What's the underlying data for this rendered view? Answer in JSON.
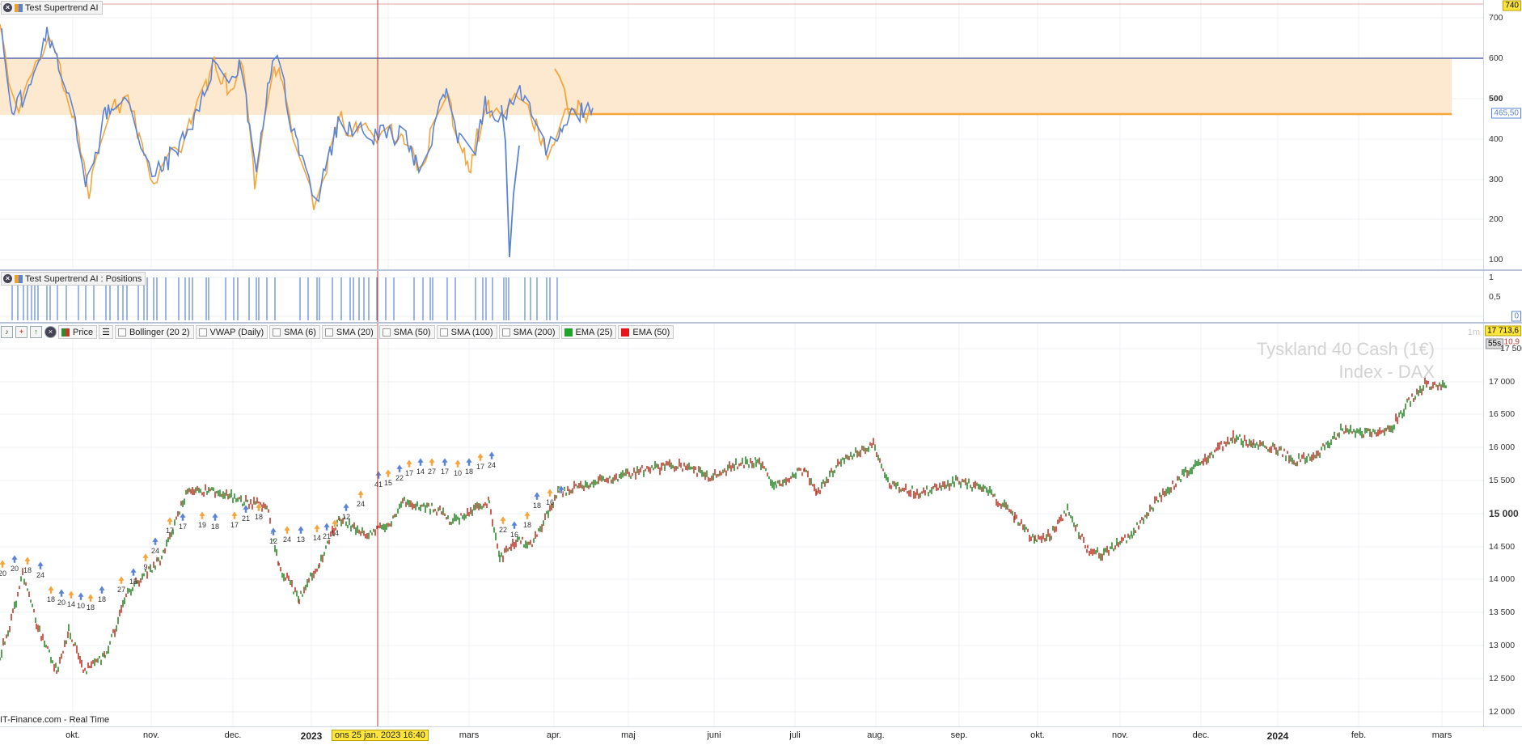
{
  "panel1": {
    "title": "Test Supertrend AI",
    "y_ticks": [
      "700",
      "600",
      "500",
      "400",
      "300",
      "200",
      "100"
    ],
    "top_value": "740",
    "current_value": "465,50",
    "level_value": "600"
  },
  "panel2": {
    "title": "Test Supertrend AI : Positions",
    "y_ticks": [
      "1",
      "0,5",
      "0"
    ]
  },
  "panel3": {
    "toolbar": {
      "price_label": "Price",
      "indicators": [
        "Bollinger (20 2)",
        "VWAP (Daily)",
        "SMA (6)",
        "SMA (20)",
        "SMA (50)",
        "SMA (100)",
        "SMA (200)",
        "EMA (25)",
        "EMA (50)"
      ],
      "indicator_colors": [
        "",
        "",
        "",
        "",
        "",
        "",
        "",
        "#21a32b",
        "#e8141b"
      ]
    },
    "watermark_line1": "Tyskland 40 Cash (1€)",
    "watermark_line2": "Index - DAX",
    "timeframe": "1m",
    "price_tag": "17 713,6",
    "countdown": "55s",
    "change_tag": "10,9",
    "y_ticks": [
      "17 500",
      "17 000",
      "16 500",
      "16 000",
      "15 500",
      "15 000",
      "14 500",
      "14 000",
      "13 500",
      "13 000",
      "12 500",
      "12 000"
    ],
    "bold_tick": "15 000",
    "source": "IT-Finance.com - Real Time",
    "signal_labels_sample": [
      "20",
      "20",
      "18",
      "24",
      "18",
      "20",
      "14",
      "10",
      "18",
      "18",
      "27",
      "15",
      "9",
      "24",
      "17",
      "17",
      "19",
      "18",
      "17",
      "21",
      "18",
      "12",
      "24",
      "13",
      "14",
      "21",
      "14",
      "12",
      "24",
      "41",
      "15",
      "22",
      "17",
      "14",
      "27",
      "17",
      "10",
      "18",
      "17",
      "24",
      "22",
      "16",
      "18",
      "18",
      "16"
    ]
  },
  "x_axis": {
    "labels": [
      "okt.",
      "nov.",
      "dec.",
      "2023",
      "mars",
      "apr.",
      "maj",
      "juni",
      "juli",
      "aug.",
      "sep.",
      "okt.",
      "nov.",
      "dec.",
      "2024",
      "feb.",
      "mars"
    ],
    "bold_labels": [
      "2023",
      "2024"
    ],
    "cursor_date": "ons 25 jan. 2023 16:40"
  },
  "colors": {
    "supertrend_orange": "#f5a53a",
    "supertrend_blue": "#5b84d6",
    "band_fill": "#fde9cf",
    "level_line": "#3a4ca8",
    "cursor_line": "#c0392b",
    "candle_up": "#2e8b2e",
    "candle_down": "#c0392b"
  }
}
